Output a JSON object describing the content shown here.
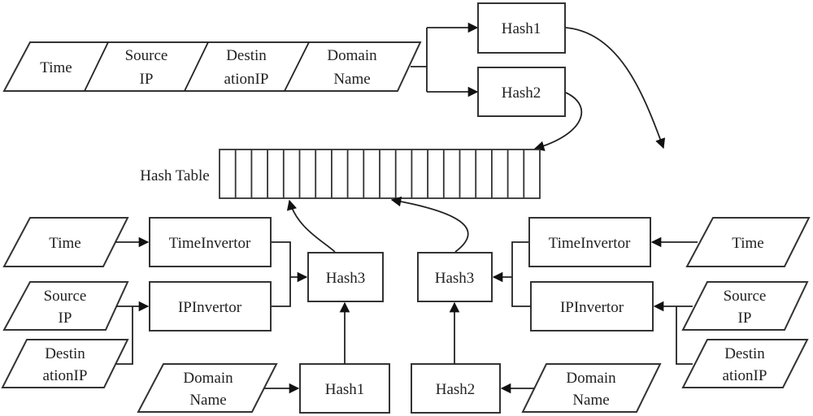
{
  "diagram": {
    "top_record": {
      "fields": [
        {
          "line1": "Time",
          "line2": ""
        },
        {
          "line1": "Source",
          "line2": "IP"
        },
        {
          "line1": "Destin",
          "line2": "ationIP"
        },
        {
          "line1": "Domain",
          "line2": "Name"
        }
      ]
    },
    "top_hashes": {
      "hash1": "Hash1",
      "hash2": "Hash2"
    },
    "hash_table": {
      "label": "Hash Table",
      "cell_count": 20
    },
    "left_group": {
      "time": "Time",
      "source_ip": {
        "line1": "Source",
        "line2": "IP"
      },
      "destination_ip": {
        "line1": "Destin",
        "line2": "ationIP"
      },
      "domain_name": {
        "line1": "Domain",
        "line2": "Name"
      },
      "time_invertor": "TimeInvertor",
      "ip_invertor": "IPInvertor",
      "hash3": "Hash3",
      "hash": "Hash1"
    },
    "right_group": {
      "time": "Time",
      "source_ip": {
        "line1": "Source",
        "line2": "IP"
      },
      "destination_ip": {
        "line1": "Destin",
        "line2": "ationIP"
      },
      "domain_name": {
        "line1": "Domain",
        "line2": "Name"
      },
      "time_invertor": "TimeInvertor",
      "ip_invertor": "IPInvertor",
      "hash3": "Hash3",
      "hash": "Hash2"
    }
  }
}
